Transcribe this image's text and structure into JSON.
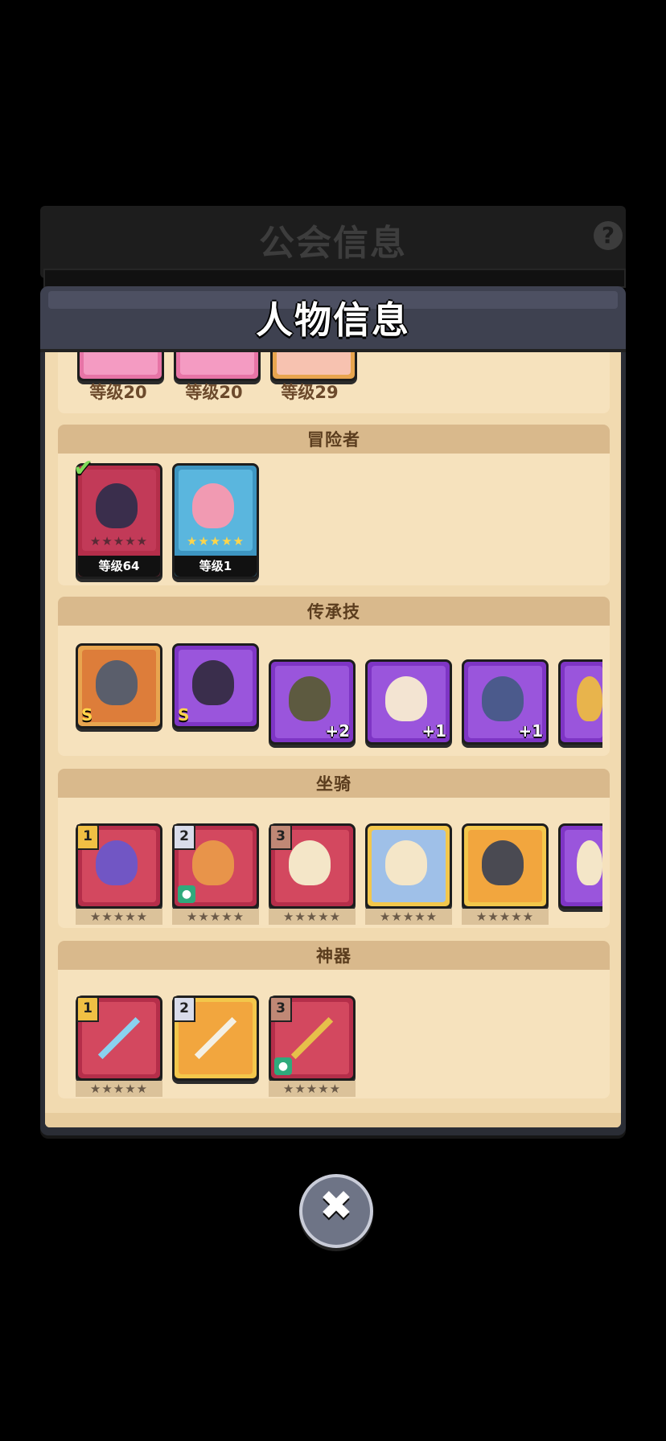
{
  "background": {
    "title": "公会信息",
    "help_icon": "?"
  },
  "dialog": {
    "title": "人物信息"
  },
  "top_row": {
    "levels": [
      "等级20",
      "等级20",
      "等级29"
    ]
  },
  "adventurers": {
    "header": "冒险者",
    "items": [
      {
        "level": "等级64",
        "selected": true,
        "stars": "★★★★★"
      },
      {
        "level": "等级1",
        "selected": false,
        "stars": "★★★★★"
      }
    ]
  },
  "legacy_skills": {
    "header": "传承技",
    "items": [
      {
        "badge": "S"
      },
      {
        "badge": "S"
      },
      {
        "badge": "+2"
      },
      {
        "badge": "+1"
      },
      {
        "badge": "+1"
      },
      {
        "badge": ""
      }
    ]
  },
  "mounts": {
    "header": "坐骑",
    "items": [
      {
        "rank": "1",
        "stars": "★★★★★"
      },
      {
        "rank": "2",
        "stars": "★★★★★"
      },
      {
        "rank": "3",
        "stars": "★★★★★"
      },
      {
        "rank": "",
        "stars": "★★★★★"
      },
      {
        "rank": "",
        "stars": "★★★★★"
      },
      {
        "rank": "",
        "stars": ""
      }
    ]
  },
  "artifacts": {
    "header": "神器",
    "items": [
      {
        "rank": "1",
        "stars": "★★★★★"
      },
      {
        "rank": "2",
        "stars": ""
      },
      {
        "rank": "3",
        "stars": "★★★★★"
      }
    ]
  },
  "close_button": {
    "symbol": "✖"
  },
  "colors": {
    "panel_bg": "#f1dab0",
    "section_header": "#d9b98c",
    "title_text": "#ffffff"
  }
}
